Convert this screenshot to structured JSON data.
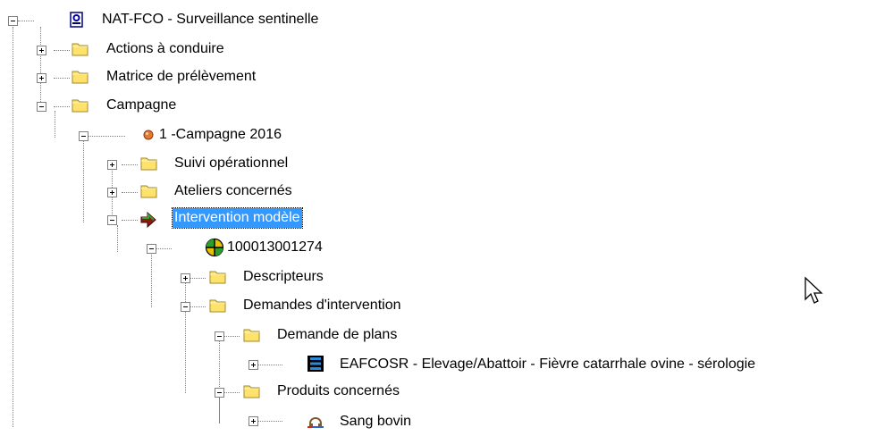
{
  "tree": {
    "root": {
      "label": "NAT-FCO - Surveillance sentinelle",
      "expanded": true
    },
    "actions": {
      "label": "Actions à conduire",
      "expanded": false
    },
    "matrice": {
      "label": "Matrice de prélèvement",
      "expanded": false
    },
    "campagne": {
      "label": "Campagne",
      "expanded": true
    },
    "campagne_2016": {
      "label": "1 -Campagne 2016",
      "expanded": true
    },
    "suivi": {
      "label": "Suivi opérationnel",
      "expanded": false
    },
    "ateliers": {
      "label": "Ateliers concernés",
      "expanded": false
    },
    "intervention_modele": {
      "label": "Intervention modèle",
      "expanded": true,
      "selected": true
    },
    "intervention_id": {
      "label": "100013001274",
      "expanded": true
    },
    "descripteurs": {
      "label": "Descripteurs",
      "expanded": false
    },
    "demandes": {
      "label": "Demandes d'intervention",
      "expanded": true
    },
    "demande_plans": {
      "label": "Demande de plans",
      "expanded": true
    },
    "eafcosr": {
      "label": "EAFCOSR - Elevage/Abattoir - Fièvre catarrhale ovine - sérologie",
      "expanded": false
    },
    "produits": {
      "label": "Produits concernés",
      "expanded": true
    },
    "sang_bovin": {
      "label": "Sang bovin",
      "expanded": false
    }
  },
  "icons": {
    "root": "database-icon",
    "folder": "folder-icon",
    "campagne_2016": "campaign-node-icon",
    "intervention_modele": "arrow-right-icon",
    "intervention_id": "target-icon",
    "eafcosr": "plan-icon",
    "sang_bovin": "sample-icon"
  },
  "colors": {
    "selection": "#3399ff",
    "folder": "#ffe26b",
    "folder_border": "#a08a2c",
    "connector": "#808080"
  }
}
